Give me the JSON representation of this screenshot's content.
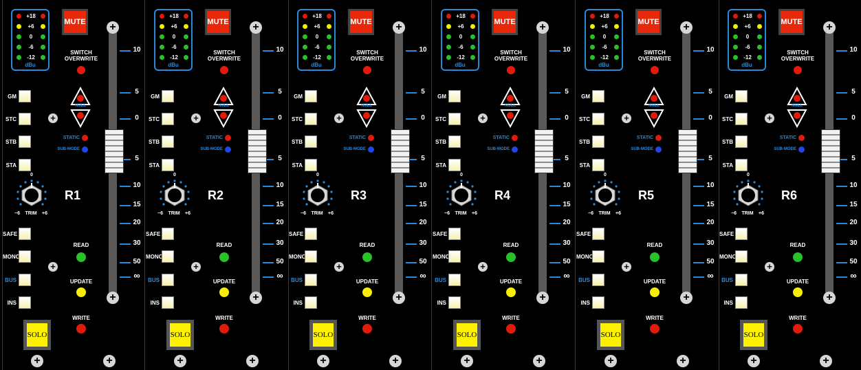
{
  "meter_labels": [
    "+18",
    "+6",
    "0",
    "-6",
    "-12"
  ],
  "meter_unit": "dBu",
  "mute_label": "MUTE",
  "switch_label_1": "SWITCH",
  "switch_label_2": "OVERWRITE",
  "null_label": "NULL",
  "static_label": "STATIC",
  "submode_label": "SUB-MODE",
  "read_label": "READ",
  "update_label": "UPDATE",
  "write_label": "WRITE",
  "solo_label": "SOLO",
  "trim_label": "TRIM",
  "trim_min": "−6",
  "trim_max": "+6",
  "trim_center": "0",
  "top_keys": [
    "GM",
    "STC",
    "STB",
    "STA"
  ],
  "bottom_keys": [
    "SAFE",
    "MONO",
    "BUS",
    "INS"
  ],
  "fader_scale": [
    "10",
    "5",
    "0",
    "5",
    "10",
    "15",
    "20",
    "30",
    "50",
    "∞"
  ],
  "channels": [
    {
      "name": "R1"
    },
    {
      "name": "R2"
    },
    {
      "name": "R3"
    },
    {
      "name": "R4"
    },
    {
      "name": "R5"
    },
    {
      "name": "R6"
    }
  ],
  "colors": {
    "meter_border": "#2a8ad8",
    "mute": "#e8280a",
    "led_red": "#e01b0c",
    "led_yellow": "#f5f000",
    "led_green": "#2bbf2b",
    "led_blue": "#1e46e8",
    "solo": "#fff200",
    "scale_line": "#2a8ad8"
  }
}
